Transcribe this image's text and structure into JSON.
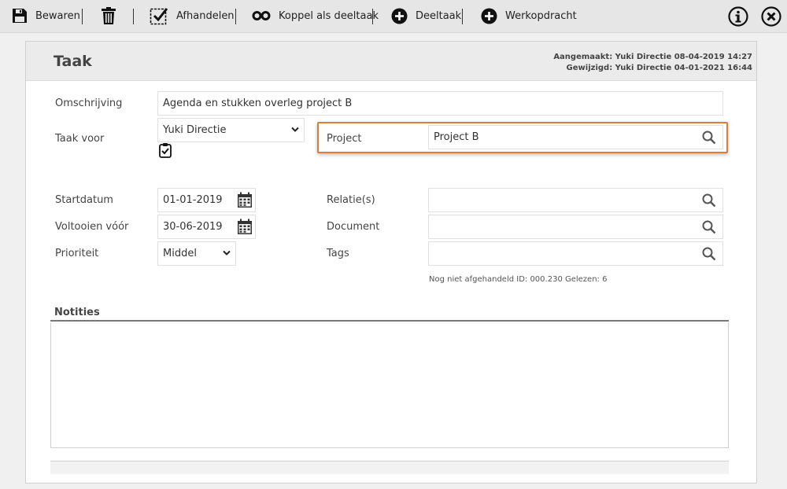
{
  "toolbar": {
    "save_label": "Bewaren",
    "complete_label": "Afhandelen",
    "link_subtask_label": "Koppel als deeltaak",
    "subtask_label": "Deeltaak",
    "workorder_label": "Werkopdracht"
  },
  "card": {
    "title": "Taak",
    "created": "Aangemaakt: Yuki Directie 08-04-2019 14:27",
    "modified": "Gewijzigd: Yuki Directie 04-01-2021 16:44"
  },
  "form": {
    "description_label": "Omschrijving",
    "description_value": "Agenda en stukken overleg project B",
    "task_for_label": "Taak voor",
    "task_for_value": "Yuki Directie",
    "project_label": "Project",
    "project_value": "Project B",
    "start_label": "Startdatum",
    "start_value": "01-01-2019",
    "due_label": "Voltooien vóór",
    "due_value": "30-06-2019",
    "priority_label": "Prioriteit",
    "priority_value": "Middel",
    "relations_label": "Relatie(s)",
    "document_label": "Document",
    "tags_label": "Tags",
    "status_note": "Nog niet afgehandeld ID: 000.230 Gelezen: 6"
  },
  "notes": {
    "label": "Notities"
  },
  "colors": {
    "highlight": "#e07b39",
    "toolbar_bg": "#e6e6e6",
    "header_bg": "#ebebeb"
  },
  "icons": [
    "save-icon",
    "trash-icon",
    "checkbox-icon",
    "infinity-icon",
    "plus-circle-icon",
    "info-icon",
    "close-icon",
    "search-icon",
    "calendar-icon",
    "chevron-down-icon",
    "clipboard-check-icon"
  ]
}
